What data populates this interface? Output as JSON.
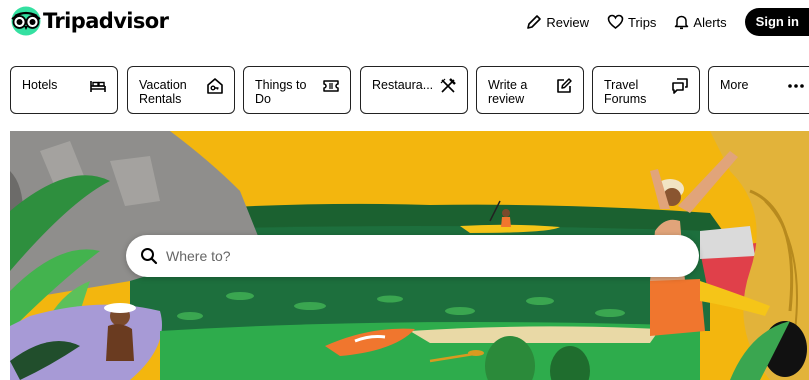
{
  "header": {
    "logo_text": "Tripadvisor",
    "nav": [
      {
        "label": "Review",
        "icon": "pencil-icon"
      },
      {
        "label": "Trips",
        "icon": "heart-icon"
      },
      {
        "label": "Alerts",
        "icon": "bell-icon"
      }
    ],
    "signin_label": "Sign in"
  },
  "categories": [
    {
      "label": "Hotels",
      "icon": "bed-icon"
    },
    {
      "label": "Vacation Rentals",
      "icon": "house-key-icon"
    },
    {
      "label": "Things to Do",
      "icon": "ticket-icon"
    },
    {
      "label": "Restaura...",
      "icon": "fork-knife-icon"
    },
    {
      "label": "Write a review",
      "icon": "edit-icon"
    },
    {
      "label": "Travel Forums",
      "icon": "chat-bubbles-icon"
    },
    {
      "label": "More",
      "icon": "ellipsis-icon"
    }
  ],
  "search": {
    "placeholder": "Where to?",
    "icon": "search-icon"
  },
  "colors": {
    "sky": "#f3b60e",
    "mountain": "#8f8e8c",
    "water": "#1d6f3d",
    "grass": "#2eac4c",
    "lavender": "#a79ad6",
    "signin_bg": "#000000"
  }
}
